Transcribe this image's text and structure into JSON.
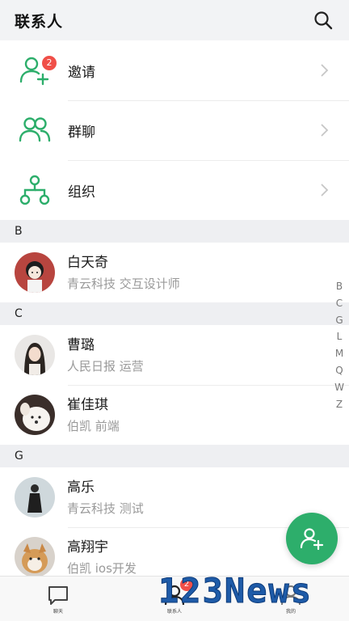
{
  "header": {
    "title": "联系人",
    "search_icon": "search-icon"
  },
  "features": [
    {
      "label": "邀请",
      "icon": "add-user-icon",
      "badge": "2"
    },
    {
      "label": "群聊",
      "icon": "group-icon"
    },
    {
      "label": "组织",
      "icon": "org-chart-icon"
    }
  ],
  "sections": [
    {
      "letter": "B",
      "contacts": [
        {
          "name": "白天奇",
          "subtitle": "青云科技 交互设计师"
        }
      ]
    },
    {
      "letter": "C",
      "contacts": [
        {
          "name": "曹璐",
          "subtitle": "人民日报 运营"
        },
        {
          "name": "崔佳琪",
          "subtitle": "伯凯 前端"
        }
      ]
    },
    {
      "letter": "G",
      "contacts": [
        {
          "name": "高乐",
          "subtitle": "青云科技 测试"
        },
        {
          "name": "高翔宇",
          "subtitle": "伯凯 ios开发"
        }
      ]
    }
  ],
  "alpha_index": [
    "B",
    "C",
    "G",
    "L",
    "M",
    "Q",
    "W",
    "Z"
  ],
  "tabbar": {
    "tabs": [
      {
        "label": "聊天",
        "icon": "chat-icon"
      },
      {
        "label": "联系人",
        "icon": "contacts-icon",
        "badge": "2"
      },
      {
        "label": "我的",
        "icon": "profile-icon"
      }
    ]
  },
  "watermark": "123News",
  "colors": {
    "accent": "#2dae6b",
    "badge": "#f04f48"
  }
}
